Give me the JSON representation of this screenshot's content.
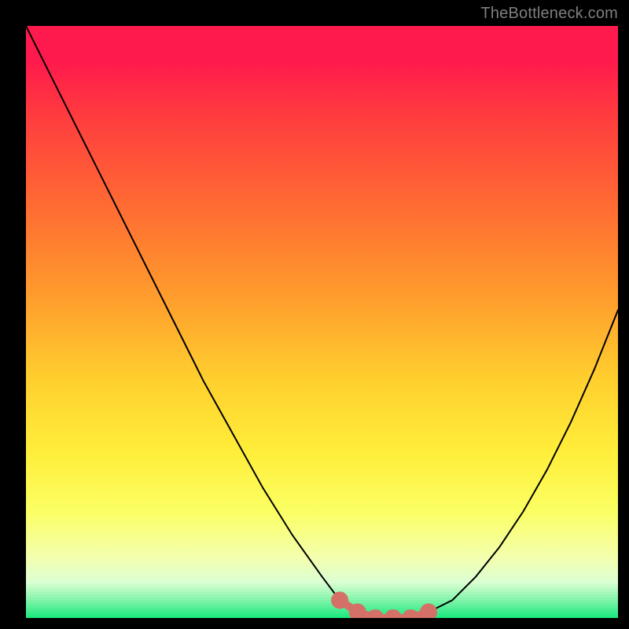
{
  "watermark": "TheBottleneck.com",
  "chart_data": {
    "type": "line",
    "title": "",
    "xlabel": "",
    "ylabel": "",
    "xlim": [
      0,
      100
    ],
    "ylim": [
      0,
      100
    ],
    "grid": false,
    "series": [
      {
        "name": "bottleneck-curve",
        "x": [
          0,
          5,
          10,
          15,
          20,
          25,
          30,
          35,
          40,
          45,
          50,
          53,
          56,
          59,
          62,
          65,
          68,
          72,
          76,
          80,
          84,
          88,
          92,
          96,
          100
        ],
        "values": [
          100,
          90,
          80,
          70,
          60,
          50,
          40,
          31,
          22,
          14,
          7,
          3,
          1,
          0,
          0,
          0,
          1,
          3,
          7,
          12,
          18,
          25,
          33,
          42,
          52
        ]
      }
    ],
    "markers": {
      "name": "minimum-highlight",
      "color": "#d57067",
      "x": [
        53,
        56,
        59,
        62,
        65,
        68
      ],
      "values": [
        3,
        1,
        0,
        0,
        0,
        1
      ]
    },
    "background_gradient_stops": [
      {
        "pos": 0,
        "color": "#ff1a4d"
      },
      {
        "pos": 15,
        "color": "#ff3b3f"
      },
      {
        "pos": 30,
        "color": "#ff6a33"
      },
      {
        "pos": 45,
        "color": "#ff9a2d"
      },
      {
        "pos": 60,
        "color": "#ffd02e"
      },
      {
        "pos": 72,
        "color": "#ffee3a"
      },
      {
        "pos": 82,
        "color": "#fbff63"
      },
      {
        "pos": 90,
        "color": "#f3ffb0"
      },
      {
        "pos": 94,
        "color": "#d9ffd0"
      },
      {
        "pos": 100,
        "color": "#17e876"
      }
    ]
  }
}
